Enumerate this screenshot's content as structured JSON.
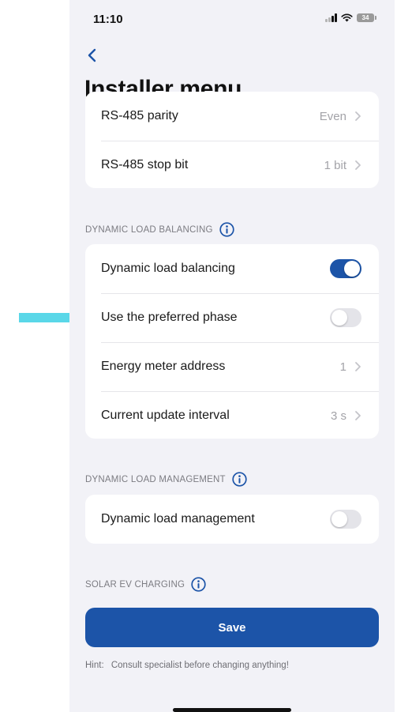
{
  "status_bar": {
    "time": "11:10",
    "battery": "34",
    "icons": [
      "signal-icon",
      "wifi-icon",
      "battery-icon"
    ]
  },
  "nav": {
    "back_icon": "chevron-left-icon",
    "title": "Installer menu"
  },
  "modbus_card": {
    "rows": [
      {
        "label": "RS-485 parity",
        "value": "Even"
      },
      {
        "label": "RS-485 stop bit",
        "value": "1 bit"
      }
    ]
  },
  "dynamic_load_balancing": {
    "header": "DYNAMIC LOAD BALANCING",
    "toggle_rows": [
      {
        "label": "Dynamic load balancing",
        "on": true
      },
      {
        "label": "Use the preferred phase",
        "on": false
      }
    ],
    "value_rows": [
      {
        "label": "Energy meter address",
        "value": "1"
      },
      {
        "label": "Current update interval",
        "value": "3 s"
      }
    ]
  },
  "dynamic_load_management": {
    "header": "DYNAMIC LOAD MANAGEMENT",
    "toggle_label": "Dynamic load management",
    "on": false
  },
  "solar_ev_charging": {
    "header": "SOLAR EV CHARGING"
  },
  "save_label": "Save",
  "hint": {
    "label": "Hint:",
    "text": "Consult specialist before changing anything!"
  },
  "colors": {
    "accent": "#1c54a8",
    "background": "#f2f2f7",
    "annotation_arrow": "#5ad7e8"
  }
}
